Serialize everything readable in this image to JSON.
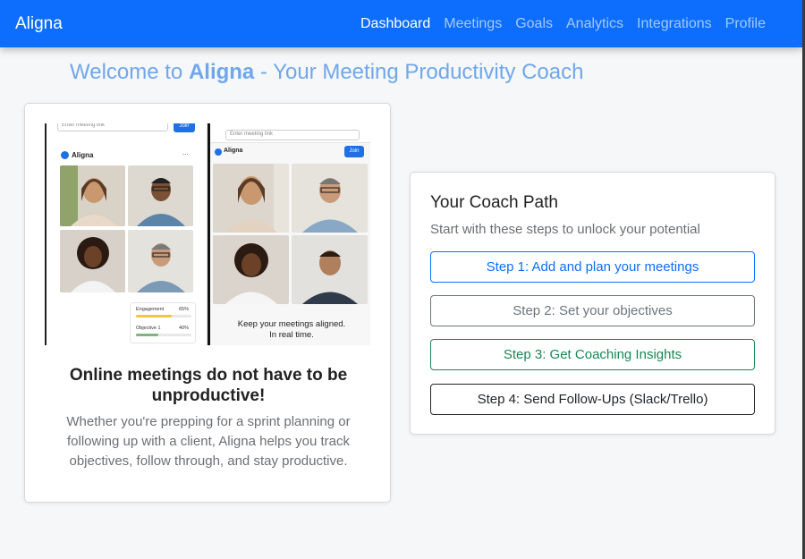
{
  "navbar": {
    "brand": "Aligna",
    "links": [
      "Dashboard",
      "Meetings",
      "Goals",
      "Analytics",
      "Integrations",
      "Profile"
    ],
    "active": "Dashboard"
  },
  "welcome": {
    "prefix": "Welcome to ",
    "brand": "Aligna",
    "suffix": " - Your Meeting Productivity Coach"
  },
  "preview": {
    "input_placeholder": "Enter meeting link",
    "join_label": "Join",
    "app_brand": "Aligna",
    "menu_dots": "...",
    "stats": [
      {
        "label": "Engagement",
        "value": "65%",
        "fraction": 0.65,
        "color": "#f0c93a"
      },
      {
        "label": "Objective 1",
        "value": "40%",
        "fraction": 0.4,
        "color": "#7cb57f"
      }
    ],
    "tagline_line1": "Keep your meetings aligned.",
    "tagline_line2": "In real time."
  },
  "intro": {
    "title": "Online meetings do not have to be unproductive!",
    "text": "Whether you're prepping for a sprint planning or following up with a client, Aligna helps you track objectives, follow through, and stay productive."
  },
  "coach": {
    "title": "Your Coach Path",
    "subtitle": "Start with these steps to unlock your potential",
    "steps": [
      "Step 1: Add and plan your meetings",
      "Step 2: Set your objectives",
      "Step 3: Get Coaching Insights",
      "Step 4: Send Follow-Ups (Slack/Trello)"
    ]
  },
  "colors": {
    "primary": "#0d6efd",
    "secondary": "#6c757d",
    "success": "#198754",
    "dark": "#212529",
    "welcome_text": "#70a7ea"
  }
}
